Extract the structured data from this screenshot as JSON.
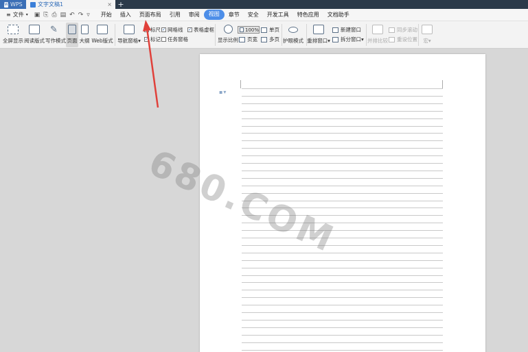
{
  "titlebar": {
    "app_tab": "WPS",
    "doc_tab": "文字文稿1",
    "close": "×",
    "add": "+"
  },
  "menubar": {
    "file": "文件",
    "items": [
      "开始",
      "插入",
      "页面布局",
      "引用",
      "审阅",
      "视图",
      "章节",
      "安全",
      "开发工具",
      "特色应用",
      "文档助手"
    ],
    "active": "视图"
  },
  "ribbon": {
    "fullscreen": "全屏显示",
    "reading": "阅读版式",
    "writing": "写作模式",
    "page": "页面",
    "outline": "大纲",
    "web": "Web版式",
    "nav_pane": "导航窗格",
    "ruler": "标尺",
    "gridlines": "网格线",
    "table_borders": "表格虚框",
    "markers": "标记",
    "task_pane": "任务窗格",
    "zoom_label": "显示比例",
    "zoom_value": "100%",
    "single_page": "单页",
    "page_width": "页宽",
    "multi_page": "多页",
    "eye_mode": "护眼模式",
    "arrange": "重排窗口",
    "new_window": "新建窗口",
    "split_window": "拆分窗口",
    "side_by_side": "并排比较",
    "sync_scroll": "同步滚动",
    "reset_position": "重设位置",
    "macro": "宏"
  },
  "document": {
    "watermark": "680.COM"
  },
  "colors": {
    "titlebar": "#2b3a4a",
    "active_menu": "#4d8ee8",
    "arrow": "#e0403a"
  }
}
